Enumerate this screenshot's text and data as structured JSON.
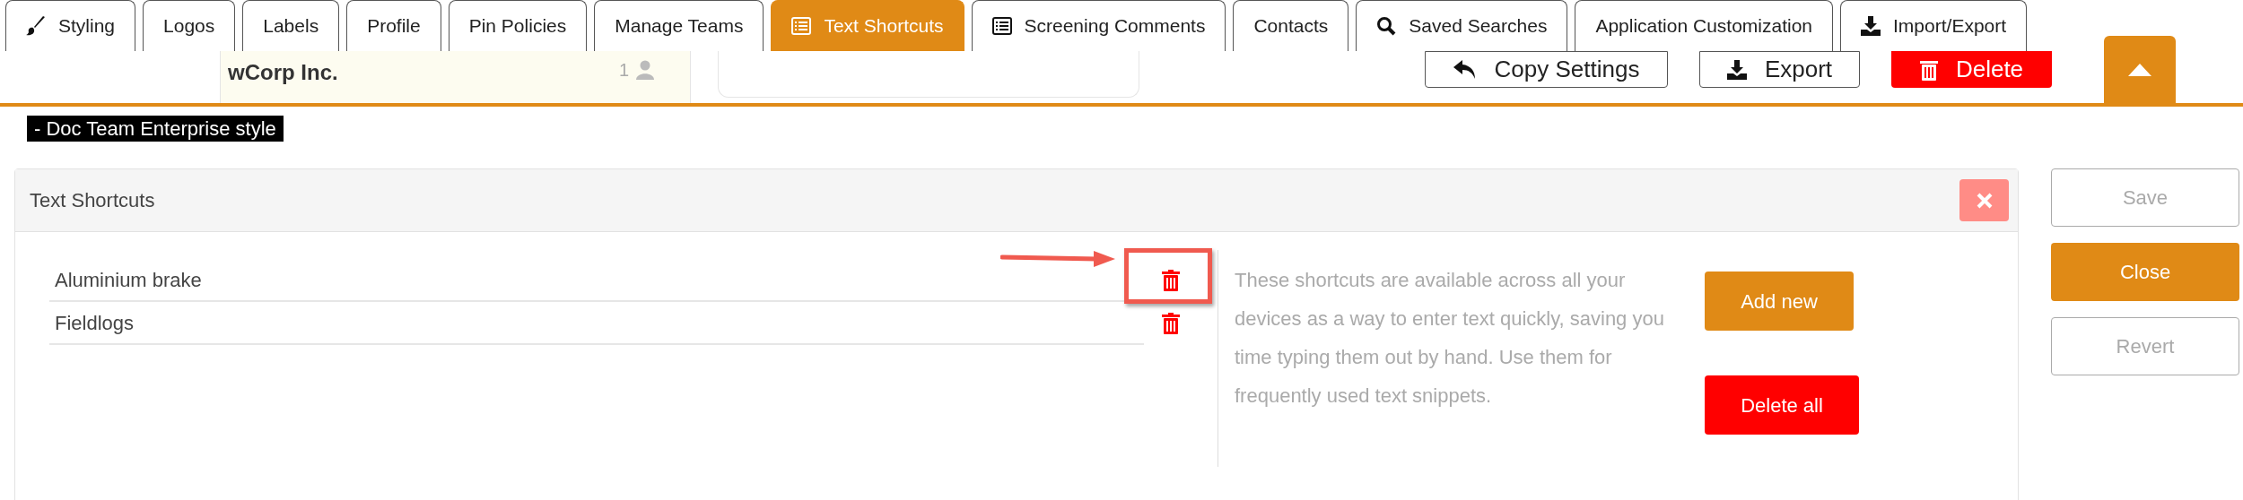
{
  "tabs": [
    {
      "label": "Styling",
      "kind": "brush",
      "selected": false
    },
    {
      "label": "Logos",
      "kind": "plain",
      "selected": false
    },
    {
      "label": "Labels",
      "kind": "plain",
      "selected": false
    },
    {
      "label": "Profile",
      "kind": "plain",
      "selected": false
    },
    {
      "label": "Pin Policies",
      "kind": "plain",
      "selected": false
    },
    {
      "label": "Manage Teams",
      "kind": "plain",
      "selected": false
    },
    {
      "label": "Text Shortcuts",
      "kind": "list",
      "selected": true
    },
    {
      "label": "Screening Comments",
      "kind": "list",
      "selected": false
    },
    {
      "label": "Contacts",
      "kind": "plain",
      "selected": false
    },
    {
      "label": "Saved Searches",
      "kind": "search",
      "selected": false
    },
    {
      "label": "Application Customization",
      "kind": "plain",
      "selected": false
    },
    {
      "label": "Import/Export",
      "kind": "download",
      "selected": false
    }
  ],
  "background": {
    "org_name": "wCorp Inc.",
    "member_count": "1"
  },
  "toolbar": [
    {
      "label": "Copy Settings",
      "kind": "undo"
    },
    {
      "label": "Export",
      "kind": "export"
    },
    {
      "label": "Delete",
      "kind": "delete"
    }
  ],
  "style_label": "- Doc Team Enterprise style",
  "panel": {
    "title": "Text Shortcuts",
    "shortcuts": [
      {
        "label": "Aluminium brake",
        "annotated": true
      },
      {
        "label": "Fieldlogs",
        "annotated": false
      }
    ],
    "description": "These shortcuts are available across all your devices as a way to enter text quickly, saving you time typing them out by hand. Use them for frequently used text snippets.",
    "actions": [
      {
        "label": "Add new",
        "kind": "primary"
      },
      {
        "label": "Delete all",
        "kind": "danger"
      }
    ]
  },
  "side_buttons": [
    {
      "label": "Save",
      "kind": "disabled"
    },
    {
      "label": "Close",
      "kind": "primary"
    },
    {
      "label": "Revert",
      "kind": "disabled"
    }
  ]
}
